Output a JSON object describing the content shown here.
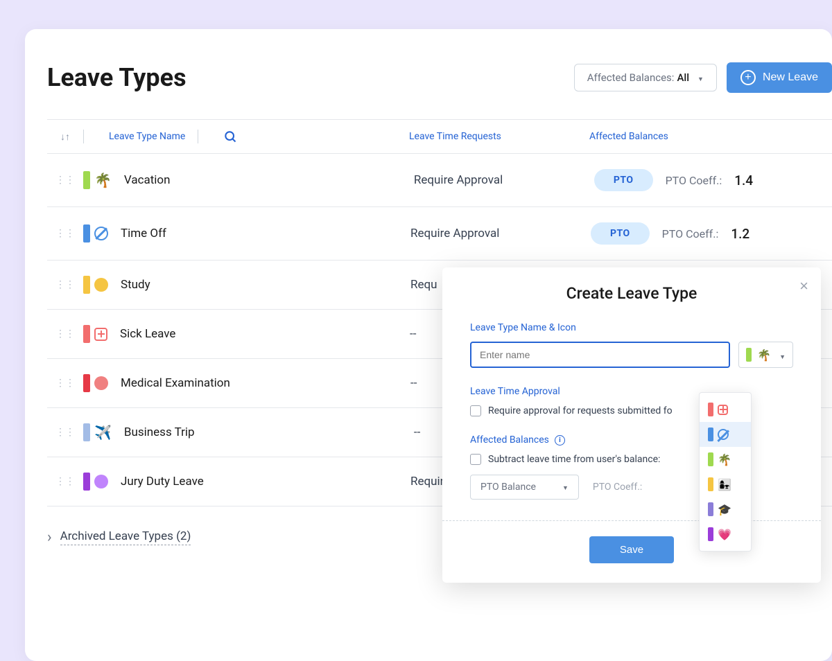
{
  "title": "Leave Types",
  "filter": {
    "label": "Affected Balances:",
    "value": "All"
  },
  "new_button": "New Leave",
  "columns": {
    "name": "Leave Type Name",
    "requests": "Leave Time Requests",
    "balances": "Affected Balances"
  },
  "coeff_label": "PTO Coeff.:",
  "rows": [
    {
      "color": "#9fd94f",
      "icon": "🌴",
      "name": "Vacation",
      "requests": "Require Approval",
      "badge": "PTO",
      "coeff": "1.4"
    },
    {
      "color": "#4a90e2",
      "icon_type": "prohibit",
      "name": "Time Off",
      "requests": "Require Approval",
      "badge": "PTO",
      "coeff": "1.2"
    },
    {
      "color": "#f5c542",
      "icon_type": "circle",
      "icon_color": "#f5c542",
      "name": "Study",
      "requests": "Requ"
    },
    {
      "color": "#f26d6d",
      "icon_type": "plus-square",
      "name": "Sick Leave",
      "requests": "--"
    },
    {
      "color": "#e63946",
      "icon_type": "circle",
      "icon_color": "#f08080",
      "name": "Medical Examination",
      "requests": "--"
    },
    {
      "color": "#a3bce6",
      "icon": "✈️",
      "name": "Business Trip",
      "requests": "--"
    },
    {
      "color": "#9b3dd9",
      "icon_type": "circle",
      "icon_color": "#c084fc",
      "name": "Jury Duty Leave",
      "requests": "Require A"
    }
  ],
  "archived": "Archived Leave Types (2)",
  "modal": {
    "title": "Create Leave Type",
    "section_name": "Leave Type Name & Icon",
    "placeholder": "Enter name",
    "selected_icon": {
      "color": "#9fd94f",
      "emoji": "🌴"
    },
    "section_approval": "Leave Time Approval",
    "approval_checkbox": "Require approval for requests submitted fo",
    "section_balances": "Affected Balances",
    "balance_checkbox": "Subtract leave time from user's balance:",
    "balance_select": "PTO Balance",
    "coeff_label": "PTO Coeff.:",
    "save": "Save"
  },
  "icon_options": [
    {
      "color": "#f26d6d",
      "type": "plus-square"
    },
    {
      "color": "#4a90e2",
      "type": "prohibit",
      "selected": true
    },
    {
      "color": "#9fd94f",
      "emoji": "🌴"
    },
    {
      "color": "#f5c542",
      "emoji": "👩‍👧"
    },
    {
      "color": "#8b7dd8",
      "emoji": "🎓"
    },
    {
      "color": "#9b3dd9",
      "emoji": "💗"
    }
  ]
}
